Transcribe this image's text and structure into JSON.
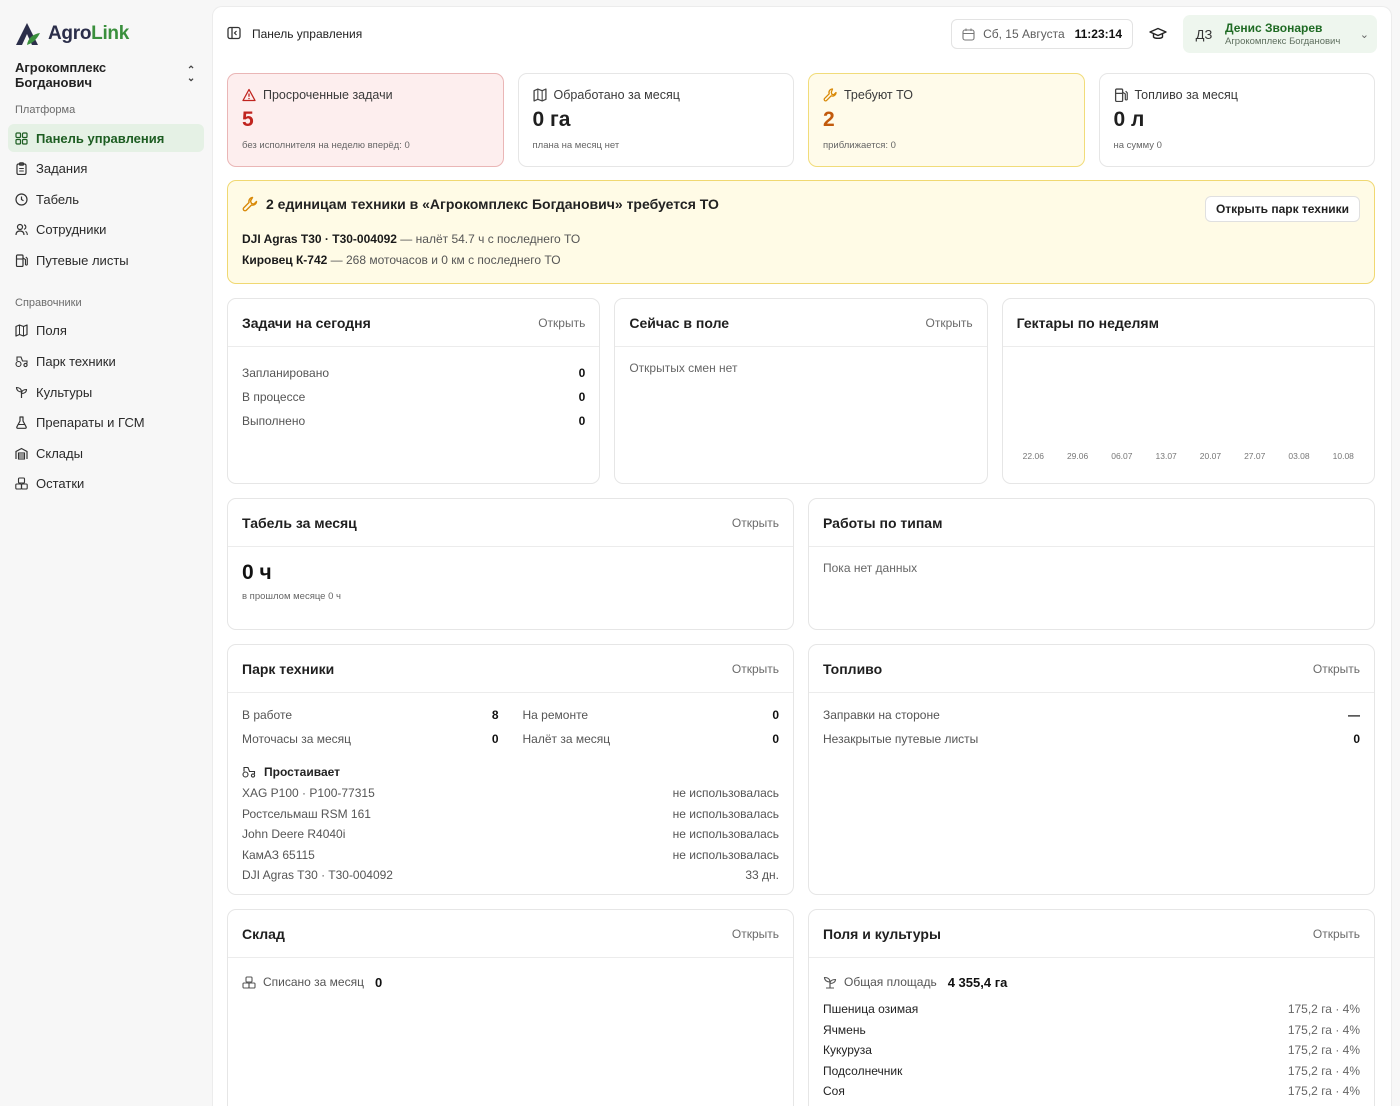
{
  "app": {
    "logo_prefix": "Agro",
    "logo_suffix": "Link",
    "org": "Агрокомплекс Богданович"
  },
  "sidebar": {
    "group_platform": "Платформа",
    "group_refs": "Справочники",
    "platform_items": [
      {
        "label": "Панель управления",
        "icon": "grid-icon",
        "active": true
      },
      {
        "label": "Задания",
        "icon": "clipboard-icon"
      },
      {
        "label": "Табель",
        "icon": "clock-icon"
      },
      {
        "label": "Сотрудники",
        "icon": "users-icon"
      },
      {
        "label": "Путевые листы",
        "icon": "fuel-icon"
      }
    ],
    "ref_items": [
      {
        "label": "Поля",
        "icon": "map-icon"
      },
      {
        "label": "Парк техники",
        "icon": "tractor-icon"
      },
      {
        "label": "Культуры",
        "icon": "sprout-icon"
      },
      {
        "label": "Препараты и ГСМ",
        "icon": "flask-icon"
      },
      {
        "label": "Склады",
        "icon": "warehouse-icon"
      },
      {
        "label": "Остатки",
        "icon": "boxes-icon"
      }
    ]
  },
  "topbar": {
    "breadcrumb": "Панель управления",
    "date": "Сб, 15 Августа",
    "time": "11:23:14",
    "user_initials": "ДЗ",
    "user_name": "Денис Звонарев",
    "user_org": "Агрокомплекс Богданович"
  },
  "kpis": [
    {
      "title": "Просроченные задачи",
      "value": "5",
      "note": "без исполнителя на неделю вперёд: 0",
      "icon": "alert-triangle-icon",
      "tone": "red"
    },
    {
      "title": "Обработано за месяц",
      "value": "0 га",
      "note": "плана на месяц нет",
      "icon": "map-icon",
      "tone": "plain"
    },
    {
      "title": "Требуют ТО",
      "value": "2",
      "note": "приближается: 0",
      "icon": "wrench-icon",
      "tone": "yellow"
    },
    {
      "title": "Топливо за месяц",
      "value": "0 л",
      "note": "на сумму 0",
      "icon": "fuel-icon",
      "tone": "plain"
    }
  ],
  "banner": {
    "title": "2 единицам техники в «Агрокомплекс Богданович» требуется ТО",
    "button": "Открыть парк техники",
    "lines": [
      {
        "name": "DJI Agras T30 · T30-004092",
        "detail": " — налёт 54.7 ч с последнего ТО"
      },
      {
        "name": "Кировец К-742",
        "detail": " — 268 моточасов и 0 км с последнего ТО"
      }
    ]
  },
  "open_label": "Открыть",
  "tasks_today": {
    "title": "Задачи на сегодня",
    "rows": [
      {
        "label": "Запланировано",
        "value": "0"
      },
      {
        "label": "В процессе",
        "value": "0"
      },
      {
        "label": "Выполнено",
        "value": "0"
      }
    ]
  },
  "in_field": {
    "title": "Сейчас в поле",
    "empty": "Открытых смен нет"
  },
  "hectares": {
    "title": "Гектары по неделям"
  },
  "chart_data": {
    "type": "bar",
    "title": "Гектары по неделям",
    "categories": [
      "22.06",
      "29.06",
      "06.07",
      "13.07",
      "20.07",
      "27.07",
      "03.08",
      "10.08"
    ],
    "values": [
      0,
      0,
      0,
      0,
      0,
      0,
      0,
      0
    ]
  },
  "timesheet": {
    "title": "Табель за месяц",
    "value": "0 ч",
    "note": "в прошлом месяце 0 ч"
  },
  "work_types": {
    "title": "Работы по типам",
    "empty": "Пока нет данных"
  },
  "fleet": {
    "title": "Парк техники",
    "left": [
      {
        "label": "В работе",
        "value": "8"
      },
      {
        "label": "Моточасы за месяц",
        "value": "0"
      }
    ],
    "right": [
      {
        "label": "На ремонте",
        "value": "0"
      },
      {
        "label": "Налёт за месяц",
        "value": "0"
      }
    ],
    "idle_title": "Простаивает",
    "idle": [
      {
        "name": "XAG P100 · P100-77315",
        "status": "не использовалась"
      },
      {
        "name": "Ростсельмаш RSM 161",
        "status": "не использовалась"
      },
      {
        "name": "John Deere R4040i",
        "status": "не использовалась"
      },
      {
        "name": "КамАЗ 65115",
        "status": "не использовалась"
      },
      {
        "name": "DJI Agras T30 · T30-004092",
        "status": "33 дн."
      }
    ]
  },
  "fuel": {
    "title": "Топливо",
    "rows": [
      {
        "label": "Заправки на стороне",
        "value": "—"
      },
      {
        "label": "Незакрытые путевые листы",
        "value": "0"
      }
    ]
  },
  "warehouse": {
    "title": "Склад",
    "label": "Списано за месяц",
    "value": "0"
  },
  "fields": {
    "title": "Поля и культуры",
    "total_label": "Общая площадь",
    "total_value": "4 355,4 га",
    "crops": [
      {
        "name": "Пшеница озимая",
        "value": "175,2 га · 4%"
      },
      {
        "name": "Ячмень",
        "value": "175,2 га · 4%"
      },
      {
        "name": "Кукуруза",
        "value": "175,2 га · 4%"
      },
      {
        "name": "Подсолнечник",
        "value": "175,2 га · 4%"
      },
      {
        "name": "Соя",
        "value": "175,2 га · 4%"
      }
    ]
  }
}
